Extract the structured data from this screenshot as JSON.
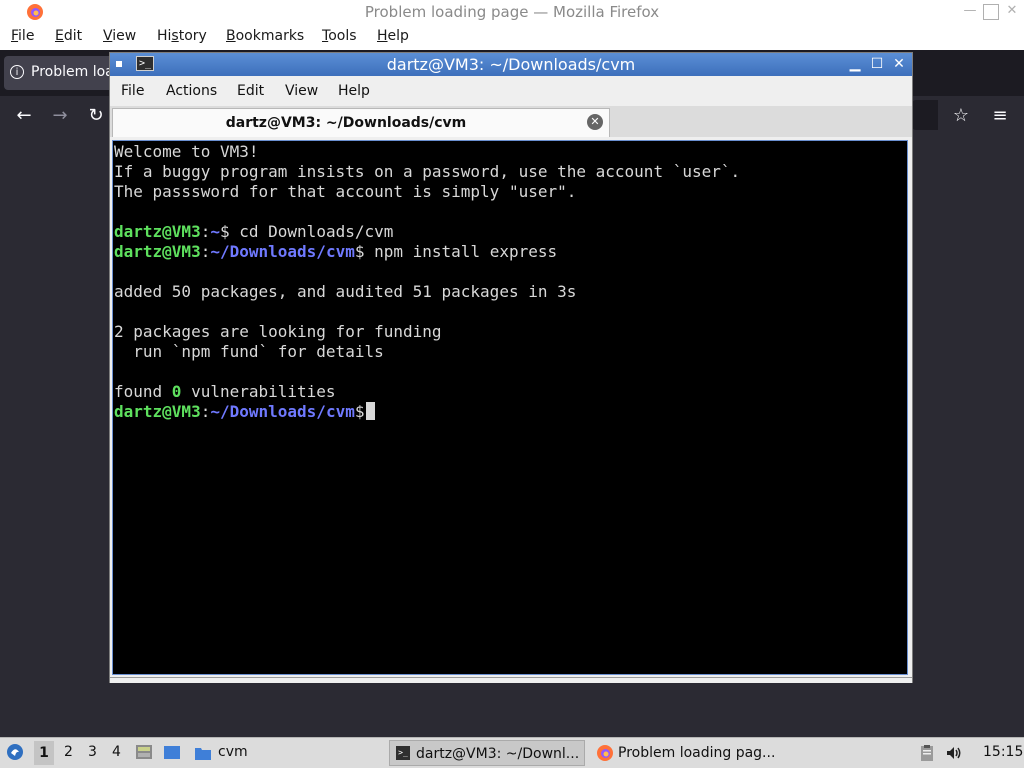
{
  "firefox": {
    "window_title": "Problem loading page — Mozilla Firefox",
    "menu": [
      "File",
      "Edit",
      "View",
      "History",
      "Bookmarks",
      "Tools",
      "Help"
    ],
    "menu_accel": [
      "F",
      "E",
      "V",
      "s",
      "B",
      "T",
      "H"
    ],
    "tab_title": "Problem loading page",
    "icons": [
      "back-arrow-icon",
      "forward-arrow-icon",
      "reload-icon",
      "bookmark-star-icon",
      "hamburger-menu-icon"
    ]
  },
  "terminal": {
    "window_title": "dartz@VM3: ~/Downloads/cvm",
    "menu": [
      "File",
      "Actions",
      "Edit",
      "View",
      "Help"
    ],
    "tab_label": "dartz@VM3: ~/Downloads/cvm",
    "lines": {
      "l0": "Welcome to VM3!",
      "l1": "If a buggy program insists on a password, use the account `user`.",
      "l2": "The passsword for that account is simply \"user\".",
      "p1_user": "dartz@VM3",
      "p1_path": "~",
      "p1_cmd": "$ cd Downloads/cvm",
      "p2_user": "dartz@VM3",
      "p2_path": "~/Downloads/cvm",
      "p2_cmd": "$ npm install express",
      "l6": "added 50 packages, and audited 51 packages in 3s",
      "l8": "2 packages are looking for funding",
      "l9": "  run `npm fund` for details",
      "l11a": "found ",
      "l11b": "0",
      "l11c": " vulnerabilities",
      "p3_user": "dartz@VM3",
      "p3_path": "~/Downloads/cvm",
      "p3_cmd": "$"
    }
  },
  "taskbar": {
    "workspaces": [
      "1",
      "2",
      "3",
      "4"
    ],
    "folder_label": "cvm",
    "windows": [
      "dartz@VM3: ~/Downl...",
      "Problem loading pag..."
    ],
    "clock": "15:15"
  }
}
